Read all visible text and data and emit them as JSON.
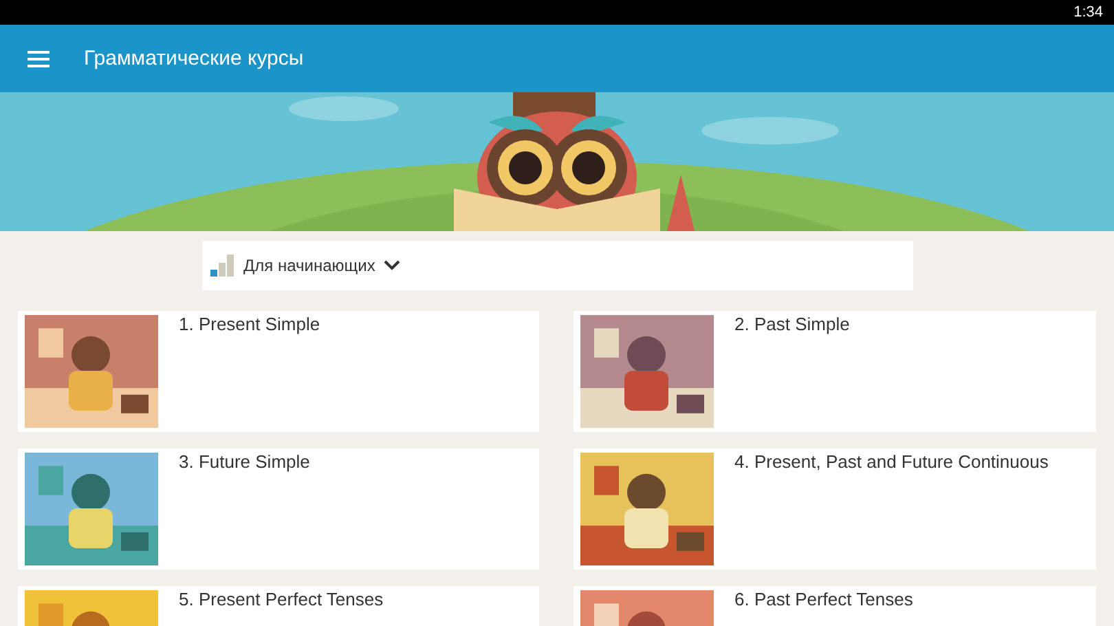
{
  "status_bar": {
    "time": "1:34"
  },
  "app_bar": {
    "title": "Грамматические курсы"
  },
  "level_selector": {
    "label": "Для начинающих"
  },
  "courses": [
    {
      "title": "1. Present Simple"
    },
    {
      "title": "2. Past Simple"
    },
    {
      "title": "3. Future Simple"
    },
    {
      "title": "4. Present, Past and Future Continuous"
    },
    {
      "title": "5. Present Perfect Tenses"
    },
    {
      "title": "6. Past Perfect Tenses"
    }
  ]
}
